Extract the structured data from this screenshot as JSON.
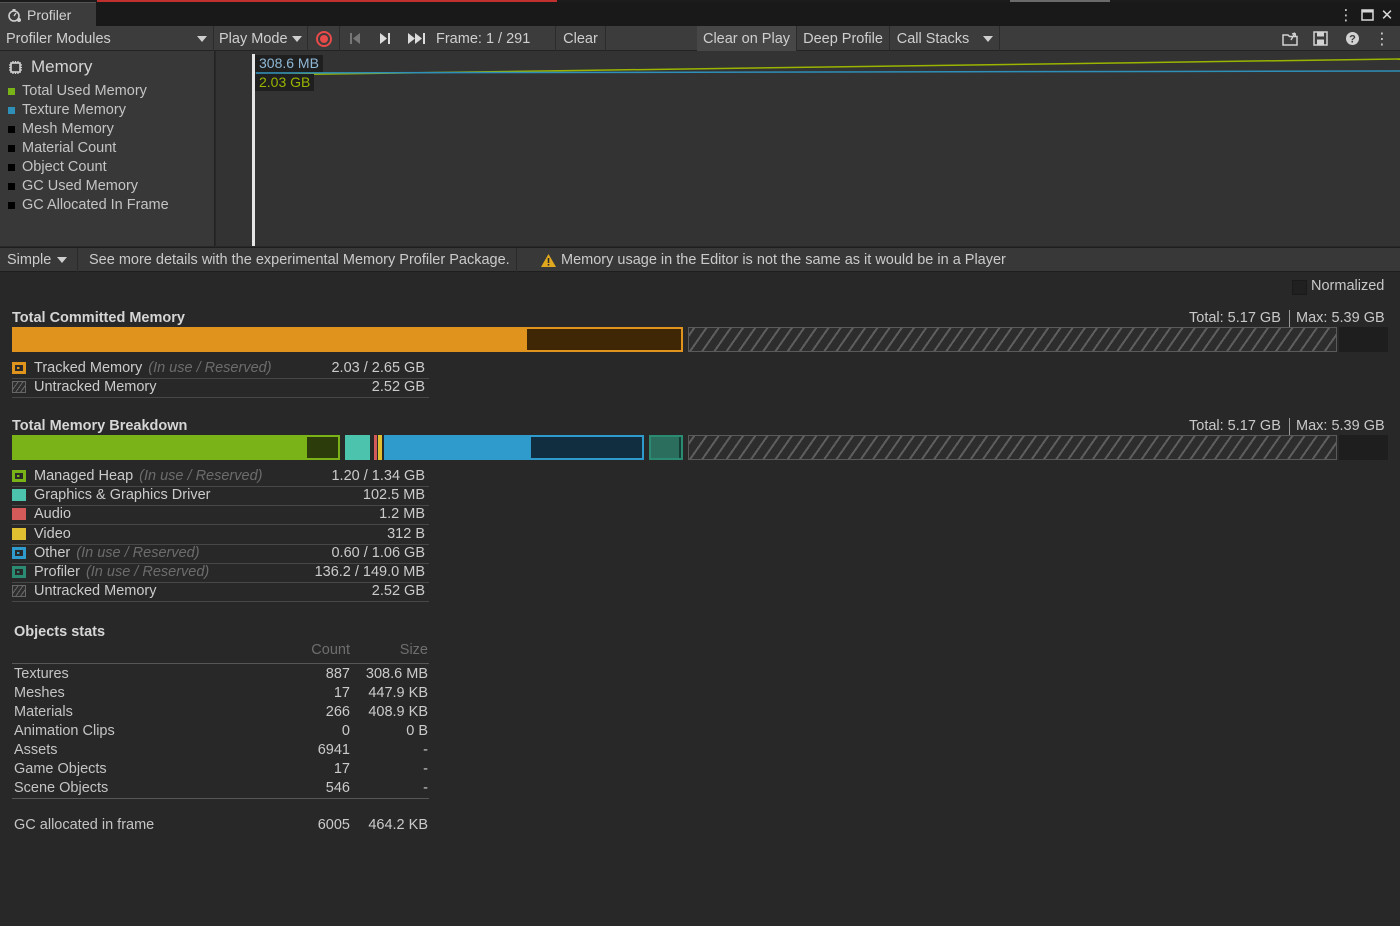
{
  "window": {
    "tab_title": "Profiler",
    "menu_icon": "kebab-menu-icon",
    "maximize_icon": "maximize-icon",
    "close_icon": "close-icon"
  },
  "toolbar": {
    "modules_dropdown": "Profiler Modules",
    "play_mode": "Play Mode",
    "frame": "Frame: 1 / 291",
    "clear": "Clear",
    "clear_on_play": "Clear on Play",
    "deep_profile": "Deep Profile",
    "call_stacks": "Call Stacks"
  },
  "module": {
    "title": "Memory",
    "counters": [
      {
        "label": "Total Used Memory",
        "color": "#7ab317"
      },
      {
        "label": "Texture Memory",
        "color": "#2e8fb8"
      },
      {
        "label": "Mesh Memory",
        "color": "#000000"
      },
      {
        "label": "Material Count",
        "color": "#000000"
      },
      {
        "label": "Object Count",
        "color": "#000000"
      },
      {
        "label": "GC Used Memory",
        "color": "#000000"
      },
      {
        "label": "GC Allocated In Frame",
        "color": "#000000"
      }
    ]
  },
  "chart": {
    "texture_label": "308.6 MB",
    "total_label": "2.03 GB",
    "texture_color": "#2e8fb8",
    "total_color": "#9ab400"
  },
  "infobar": {
    "view_mode": "Simple",
    "package_hint": "See more details with the experimental Memory Profiler Package.",
    "warning": "Memory usage in the Editor is not the same as it would be in a Player"
  },
  "normalized_label": "Normalized",
  "committed": {
    "title": "Total Committed Memory",
    "total": "Total: 5.17 GB",
    "max": "Max: 5.39 GB",
    "rows": [
      {
        "label": "Tracked Memory",
        "note": "(In use / Reserved)",
        "value": "2.03 / 2.65 GB",
        "color": "#e0941e"
      },
      {
        "label": "Untracked Memory",
        "note": "",
        "value": "2.52 GB",
        "color": "#3a3a3a"
      }
    ]
  },
  "breakdown": {
    "title": "Total Memory Breakdown",
    "total": "Total: 5.17 GB",
    "max": "Max: 5.39 GB",
    "rows": [
      {
        "label": "Managed Heap",
        "note": "(In use / Reserved)",
        "value": "1.20 / 1.34 GB",
        "color": "#7ab317"
      },
      {
        "label": "Graphics & Graphics Driver",
        "note": "",
        "value": "102.5 MB",
        "color": "#4cc3ad"
      },
      {
        "label": "Audio",
        "note": "",
        "value": "1.2 MB",
        "color": "#d45a5a"
      },
      {
        "label": "Video",
        "note": "",
        "value": "312 B",
        "color": "#e0c030"
      },
      {
        "label": "Other",
        "note": "(In use / Reserved)",
        "value": "0.60 / 1.06 GB",
        "color": "#2e9bcc"
      },
      {
        "label": "Profiler",
        "note": "(In use / Reserved)",
        "value": "136.2 / 149.0 MB",
        "color": "#2b8a72"
      },
      {
        "label": "Untracked Memory",
        "note": "",
        "value": "2.52 GB",
        "color": "#3a3a3a"
      }
    ]
  },
  "objects": {
    "title": "Objects stats",
    "col_count": "Count",
    "col_size": "Size",
    "rows": [
      {
        "name": "Textures",
        "count": "887",
        "size": "308.6 MB"
      },
      {
        "name": "Meshes",
        "count": "17",
        "size": "447.9 KB"
      },
      {
        "name": "Materials",
        "count": "266",
        "size": "408.9 KB"
      },
      {
        "name": "Animation Clips",
        "count": "0",
        "size": "0 B"
      },
      {
        "name": "Assets",
        "count": "6941",
        "size": "-"
      },
      {
        "name": "Game Objects",
        "count": "17",
        "size": "-"
      },
      {
        "name": "Scene Objects",
        "count": "546",
        "size": "-"
      }
    ],
    "gc_label": "GC allocated in frame",
    "gc_count": "6005",
    "gc_size": "464.2 KB"
  }
}
